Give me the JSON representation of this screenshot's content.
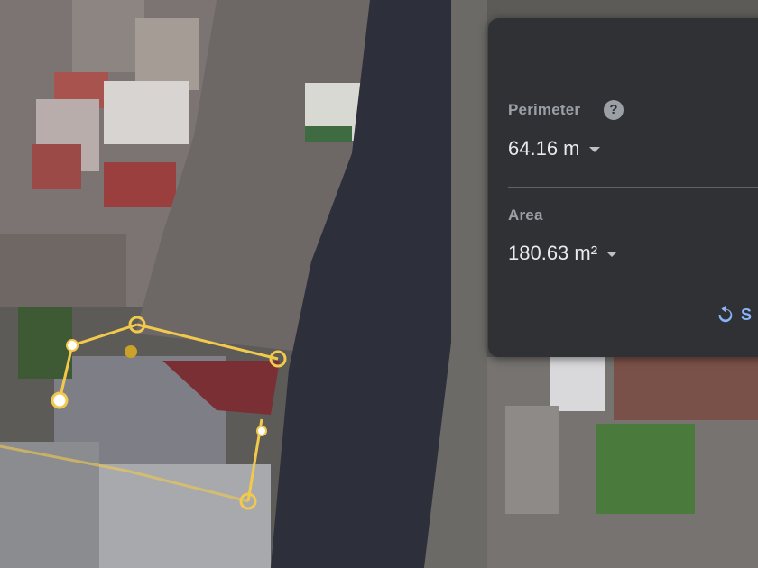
{
  "measure_panel": {
    "perimeter_label": "Perimeter",
    "perimeter_value": "64.16 m",
    "area_label": "Area",
    "area_value": "180.63 m²",
    "save_label": "S"
  },
  "icons": {
    "help": "help-icon",
    "dropdown": "caret-down-icon",
    "undo": "undo-icon"
  },
  "colors": {
    "panel_bg": "#303134",
    "accent": "#8ab4f8",
    "measure_line": "#f2c94c"
  }
}
